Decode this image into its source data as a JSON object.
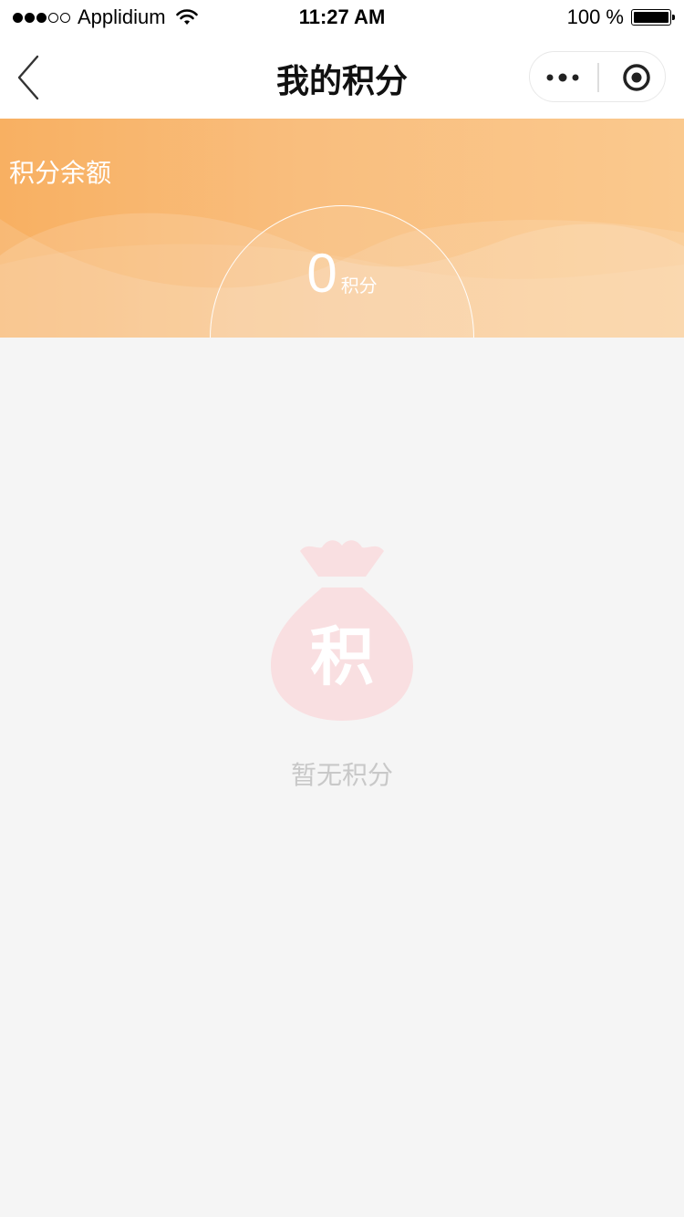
{
  "status_bar": {
    "carrier": "Applidium",
    "time": "11:27 AM",
    "battery_percent": "100 %",
    "signal_strength_of_5": 3
  },
  "nav": {
    "title": "我的积分",
    "back_icon": "chevron-left-icon",
    "more_icon": "more-dots-icon",
    "close_icon": "target-close-icon"
  },
  "banner": {
    "label": "积分余额",
    "balance": "0",
    "unit": "积分",
    "colors": {
      "start": "#f8b062",
      "end": "#fac98e"
    }
  },
  "empty_state": {
    "icon_text": "积",
    "icon": "money-bag-icon",
    "message": "暂无积分",
    "icon_color": "#f9dfe1"
  }
}
